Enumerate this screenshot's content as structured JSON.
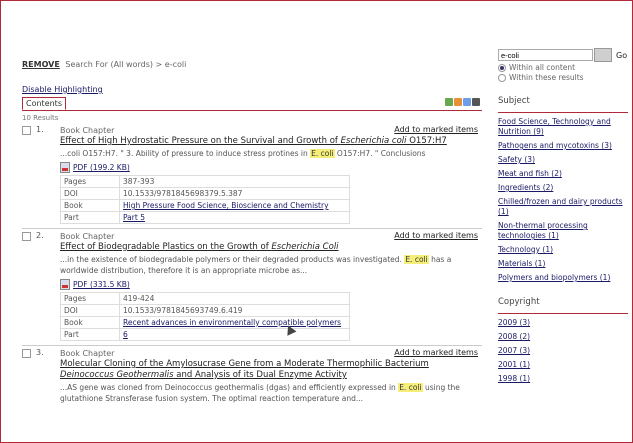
{
  "breadcrumb": {
    "remove": "REMOVE",
    "text": "Search For (All words) > e-coli"
  },
  "disable_highlighting": "Disable Highlighting",
  "tab_label": "Contents",
  "results_count": "10 Results",
  "results": [
    {
      "num": "1.",
      "type": "Book Chapter",
      "add": "Add to marked items",
      "title_pre": "Effect of High Hydrostatic Pressure on the Survival and Growth of ",
      "title_em": "Escherichia coli",
      "title_post": " O157:H7",
      "snip1": "...coli O157:H7. \" 3. Ability of pressure to induce stress protines in ",
      "snip_hl": "E. coli",
      "snip2": " O157:H7. \" Conclusions",
      "pdf": "PDF (199.2 KB)",
      "meta": [
        {
          "k": "Pages",
          "v": "387-393",
          "link": false
        },
        {
          "k": "DOI",
          "v": "10.1533/9781845698379.5.387",
          "link": false
        },
        {
          "k": "Book",
          "v": "High Pressure Food Science, Bioscience and Chemistry",
          "link": true
        },
        {
          "k": "Part",
          "v": "Part 5",
          "link": true
        }
      ]
    },
    {
      "num": "2.",
      "type": "Book Chapter",
      "add": "Add to marked items",
      "title_pre": "Effect of Biodegradable Plastics on the Growth of ",
      "title_em": "Escherichia Coli",
      "title_post": "",
      "snip1": "...in the existence of biodegradable polymers or their degraded products was investigated. ",
      "snip_hl": "E. coli",
      "snip2": " has a worldwide distribution, therefore it is an appropriate microbe as...",
      "pdf": "PDF (331.5 KB)",
      "meta": [
        {
          "k": "Pages",
          "v": "419-424",
          "link": false
        },
        {
          "k": "DOI",
          "v": "10.1533/9781845693749.6.419",
          "link": false
        },
        {
          "k": "Book",
          "v": "Recent advances in environmentally compatible polymers",
          "link": true
        },
        {
          "k": "Part",
          "v": "6",
          "link": true
        }
      ]
    },
    {
      "num": "3.",
      "type": "Book Chapter",
      "add": "Add to marked items",
      "title_pre": "Molecular Cloning of the Amylosucrase Gene from a Moderate Thermophilic Bacterium ",
      "title_em": "Deinococcus Geothermalis",
      "title_post": " and Analysis of its Dual Enzyme Activity",
      "snip1": "...AS gene was cloned from Deinococcus geothermalis (dgas) and efficiently expressed in ",
      "snip_hl": "E. coli",
      "snip2": " using the glutathione Stransferase fusion system. The optimal reaction temperature and...",
      "pdf": "",
      "meta": []
    }
  ],
  "sidebar": {
    "search_value": "e-coli",
    "go": "Go",
    "radio_all": "Within all content",
    "radio_these": "Within these results",
    "subject_head": "Subject",
    "subjects": [
      "Food Science, Technology and Nutrition (9)",
      "Pathogens and mycotoxins (3)",
      "Safety (3)",
      "Meat and fish (2)",
      "Ingredients (2)",
      "Chilled/frozen and dairy products (1)",
      "Non-thermal processing technologies (1)",
      "Technology (1)",
      "Materials (1)",
      "Polymers and biopolymers (1)"
    ],
    "copyright_head": "Copyright",
    "years": [
      "2009 (3)",
      "2008 (2)",
      "2007 (3)",
      "2001 (1)",
      "1998 (1)"
    ]
  }
}
